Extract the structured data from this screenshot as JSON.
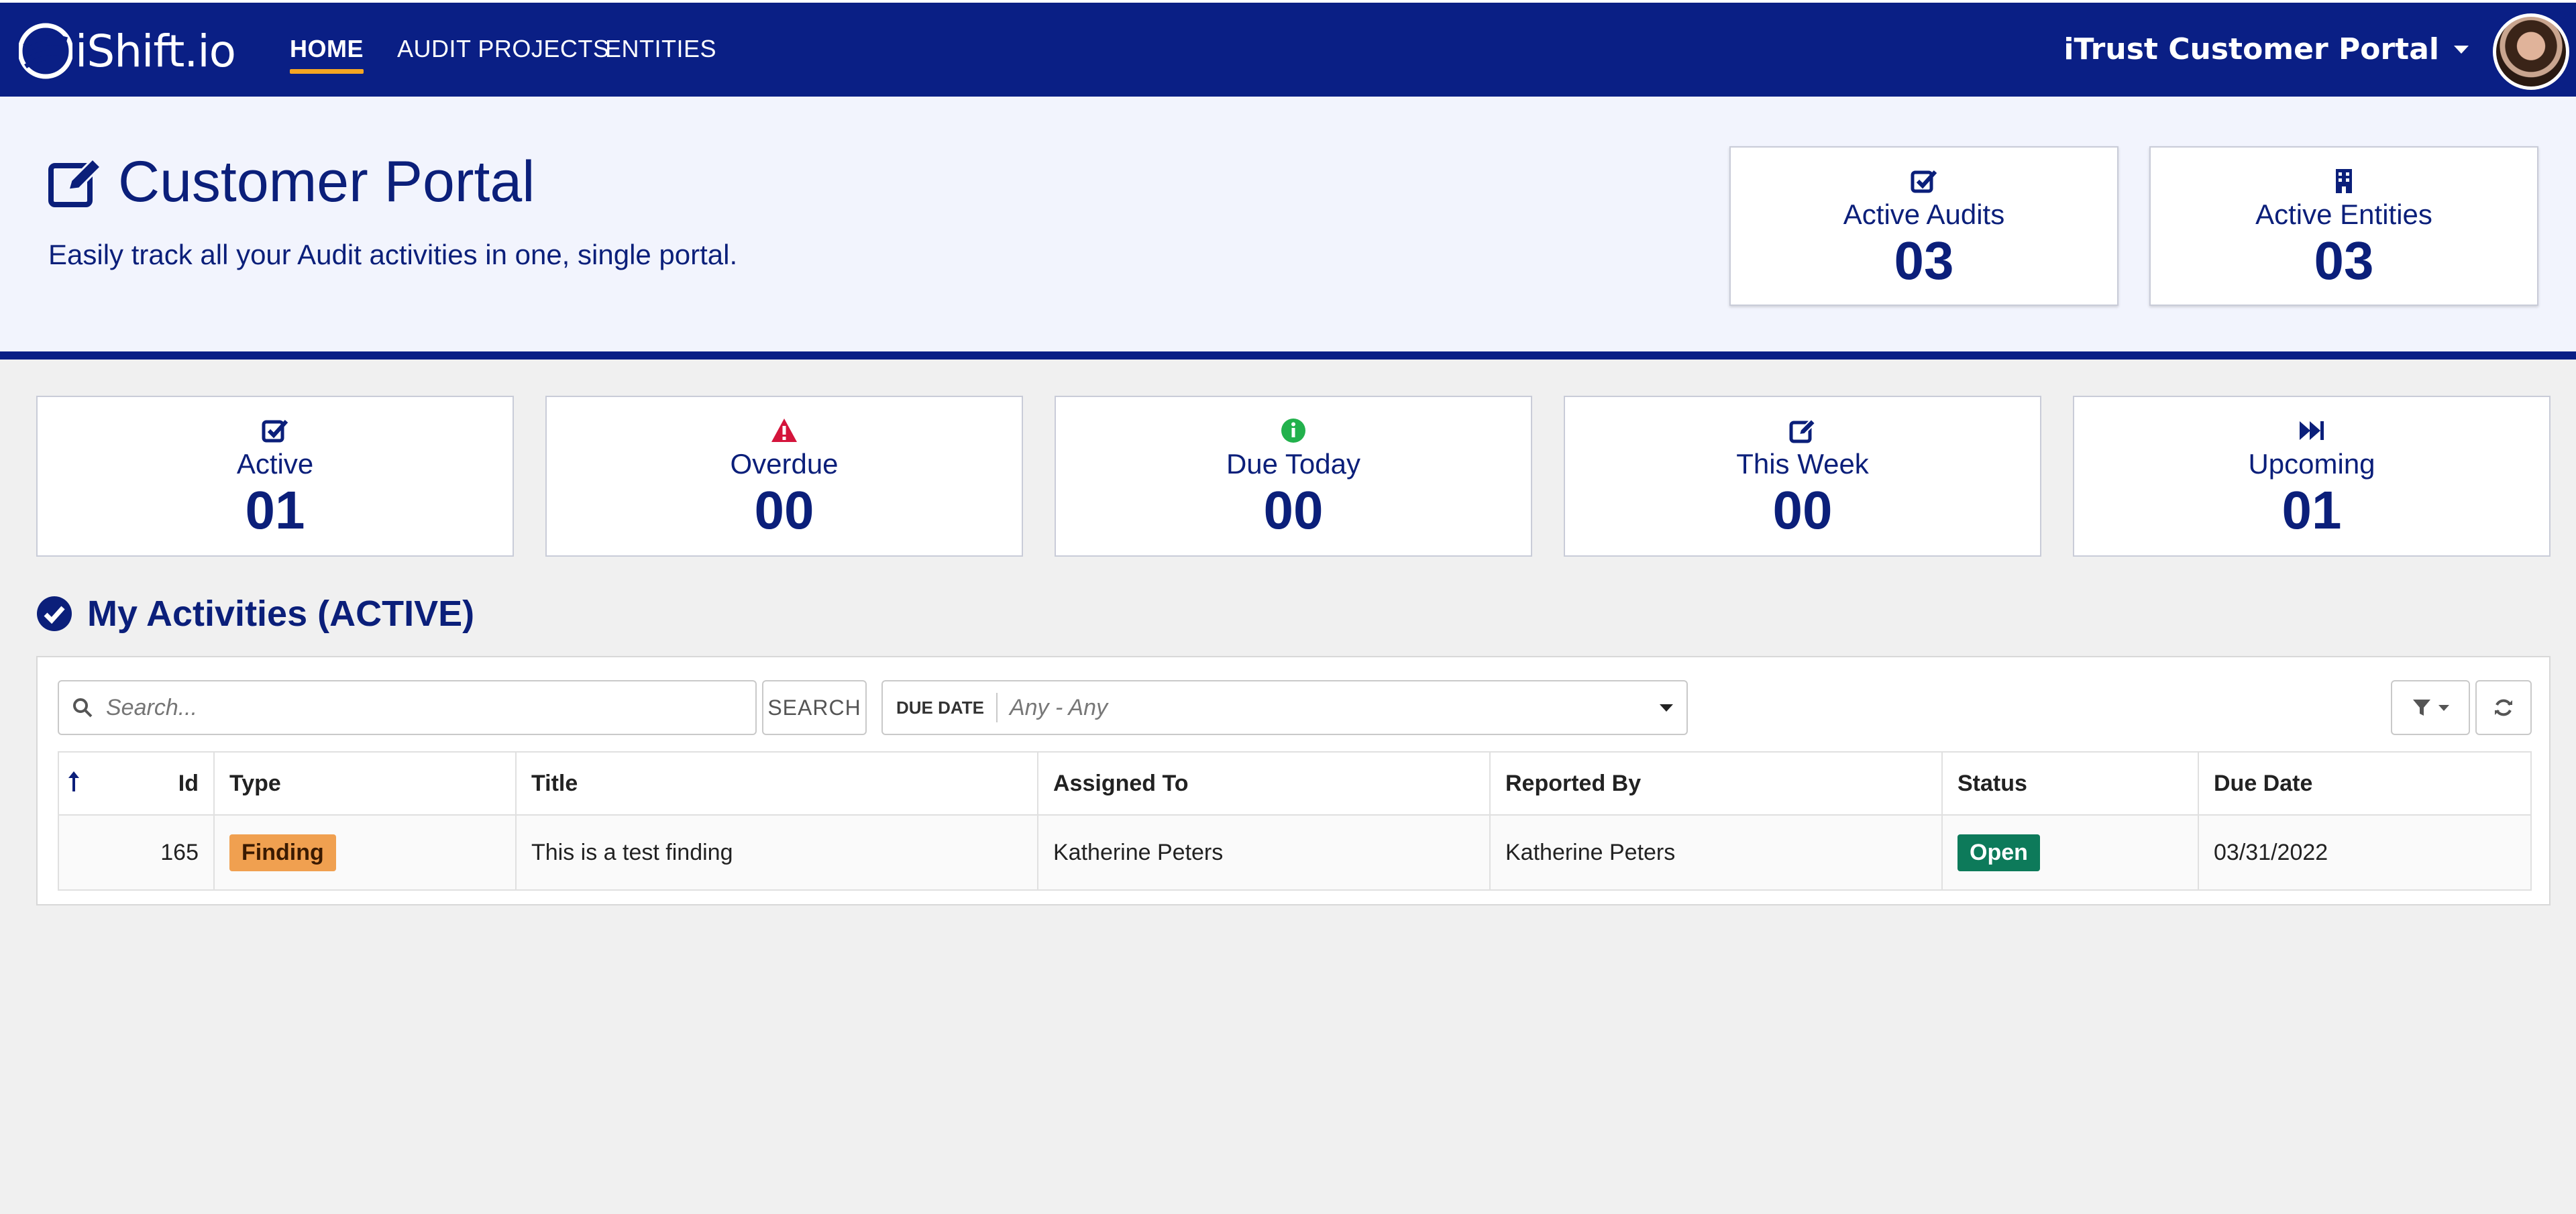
{
  "nav": {
    "logo_text": "iShift.io",
    "links": [
      {
        "label": "HOME",
        "active": true
      },
      {
        "label": "AUDIT PROJECTS",
        "active": false
      },
      {
        "label": "ENTITIES",
        "active": false
      }
    ],
    "portal_menu_label": "iTrust Customer Portal"
  },
  "hero": {
    "title": "Customer Portal",
    "subtitle": "Easily track all your Audit activities in one, single portal.",
    "cards": [
      {
        "icon": "check-square-icon",
        "label": "Active Audits",
        "value": "03"
      },
      {
        "icon": "building-icon",
        "label": "Active Entities",
        "value": "03"
      }
    ]
  },
  "stats": [
    {
      "icon": "check-square-icon",
      "label": "Active",
      "value": "01",
      "icon_color": "#0b1f7a"
    },
    {
      "icon": "warning-triangle-icon",
      "label": "Overdue",
      "value": "00",
      "icon_color": "#d4143b"
    },
    {
      "icon": "info-circle-icon",
      "label": "Due Today",
      "value": "00",
      "icon_color": "#22b14c"
    },
    {
      "icon": "edit-icon",
      "label": "This Week",
      "value": "00",
      "icon_color": "#0b1f7a"
    },
    {
      "icon": "fast-forward-icon",
      "label": "Upcoming",
      "value": "01",
      "icon_color": "#0b1f7a"
    }
  ],
  "activities": {
    "heading": "My Activities (ACTIVE)",
    "search_placeholder": "Search...",
    "search_button": "SEARCH",
    "due_date_label": "DUE DATE",
    "due_date_value": "Any - Any",
    "columns": [
      "Id",
      "Type",
      "Title",
      "Assigned To",
      "Reported By",
      "Status",
      "Due Date"
    ],
    "rows": [
      {
        "id": "165",
        "type": "Finding",
        "title": "This is a test finding",
        "assigned_to": "Katherine Peters",
        "reported_by": "Katherine Peters",
        "status": "Open",
        "due_date": "03/31/2022"
      }
    ]
  },
  "colors": {
    "brand_navy": "#0a1f85",
    "accent_underline": "#f5a623",
    "finding_badge": "#f0a050",
    "open_badge": "#0d7a5a"
  }
}
